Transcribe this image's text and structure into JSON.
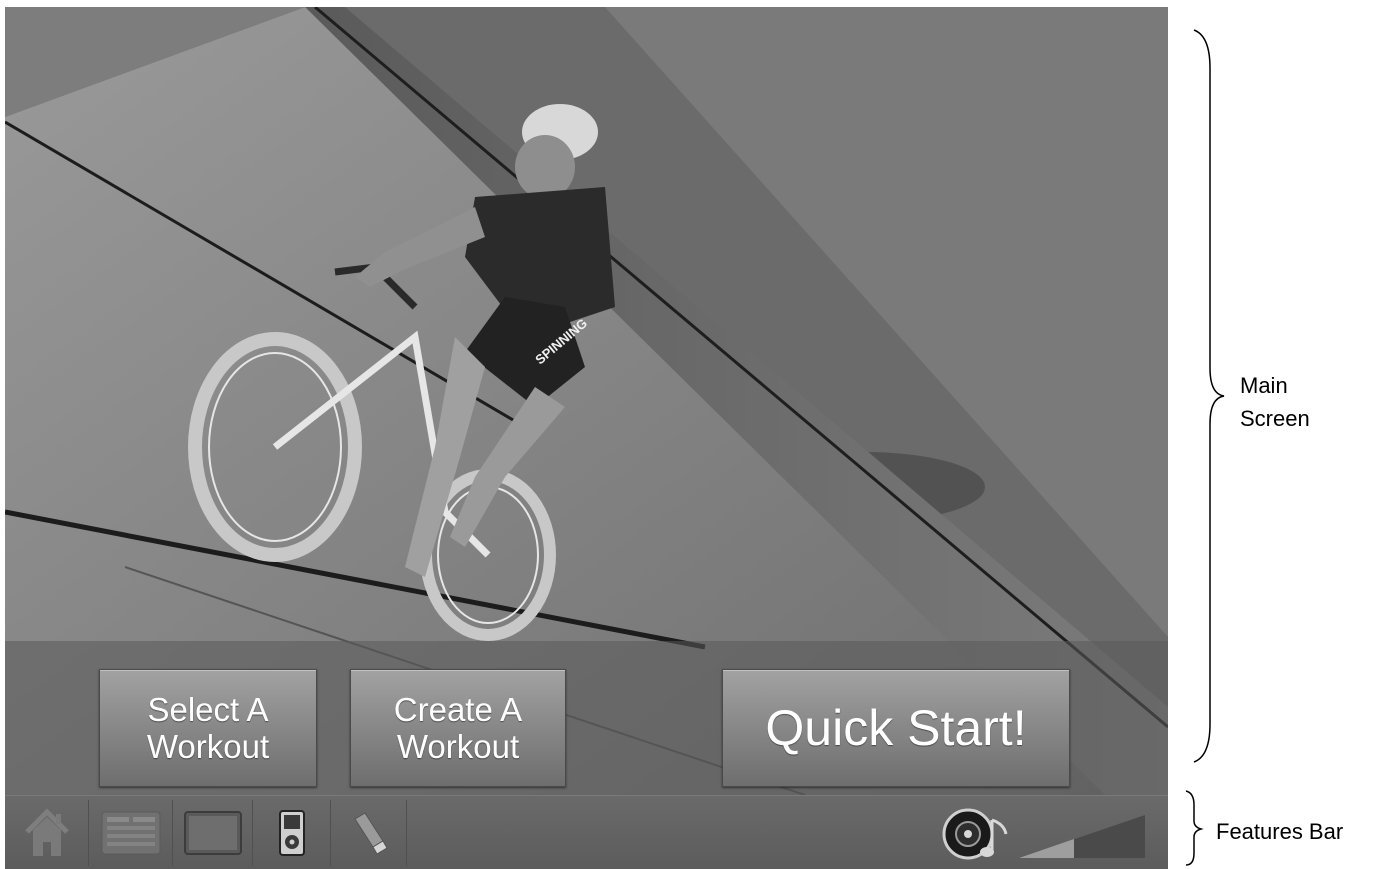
{
  "main_screen": {
    "buttons": {
      "select_workout": "Select A\nWorkout",
      "create_workout": "Create A\nWorkout",
      "quick_start": "Quick Start!"
    },
    "jersey_text": "SPINNING"
  },
  "features_bar": {
    "items": [
      {
        "name": "home",
        "icon": "home-icon"
      },
      {
        "name": "menu",
        "icon": "menu-panel-icon"
      },
      {
        "name": "tv",
        "icon": "tv-icon"
      },
      {
        "name": "ipod",
        "icon": "ipod-icon"
      },
      {
        "name": "usb",
        "icon": "usb-icon"
      }
    ],
    "speaker_icon": "speaker-icon",
    "volume_icon": "volume-level-icon"
  },
  "annotations": {
    "main_screen_label": "Main\nScreen",
    "features_bar_label": "Features Bar"
  },
  "colors": {
    "button_text": "#ffffff",
    "bar_background": "#5e5e5e"
  }
}
